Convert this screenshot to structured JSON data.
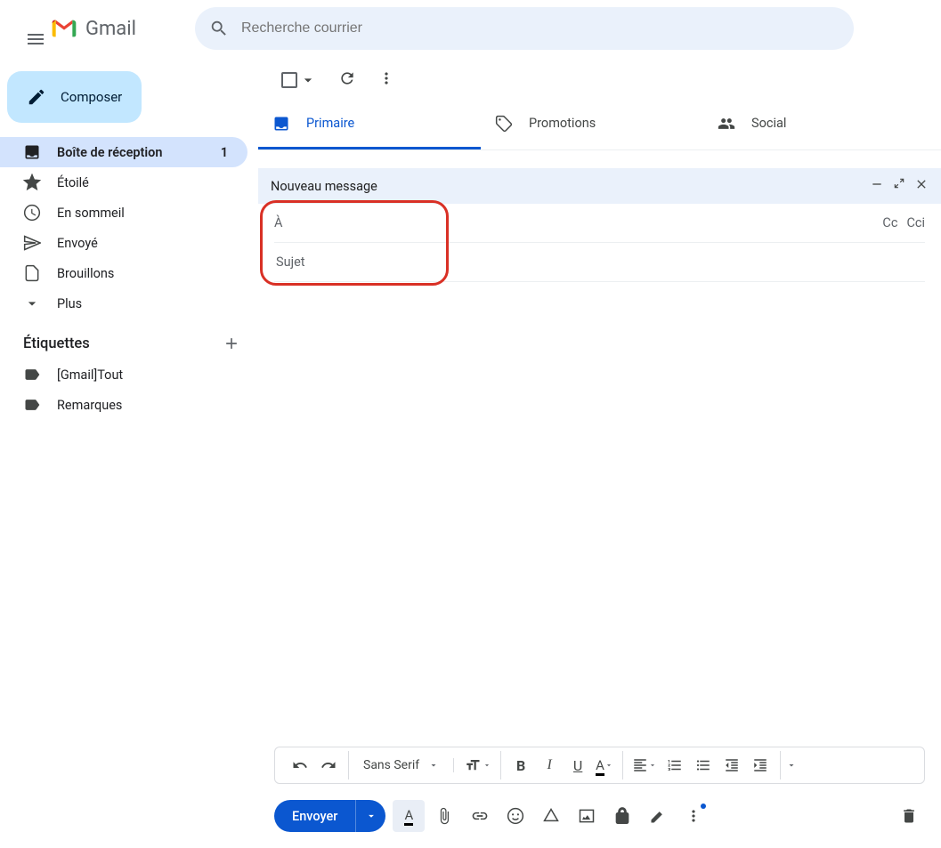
{
  "app_name": "Gmail",
  "search": {
    "placeholder": "Recherche courrier"
  },
  "compose_button": "Composer",
  "sidebar": {
    "items": [
      {
        "label": "Boîte de réception",
        "count": "1"
      },
      {
        "label": "Étoilé"
      },
      {
        "label": "En sommeil"
      },
      {
        "label": "Envoyé"
      },
      {
        "label": "Brouillons"
      },
      {
        "label": "Plus"
      }
    ],
    "labels_header": "Étiquettes",
    "labels": [
      {
        "label": "[Gmail]Tout"
      },
      {
        "label": "Remarques"
      }
    ]
  },
  "tabs": {
    "primary": "Primaire",
    "promotions": "Promotions",
    "social": "Social"
  },
  "compose": {
    "title": "Nouveau message",
    "to_label": "À",
    "cc_label": "Cc",
    "bcc_label": "Cci",
    "subject_placeholder": "Sujet"
  },
  "format_toolbar": {
    "font": "Sans Serif"
  },
  "send_button": "Envoyer"
}
